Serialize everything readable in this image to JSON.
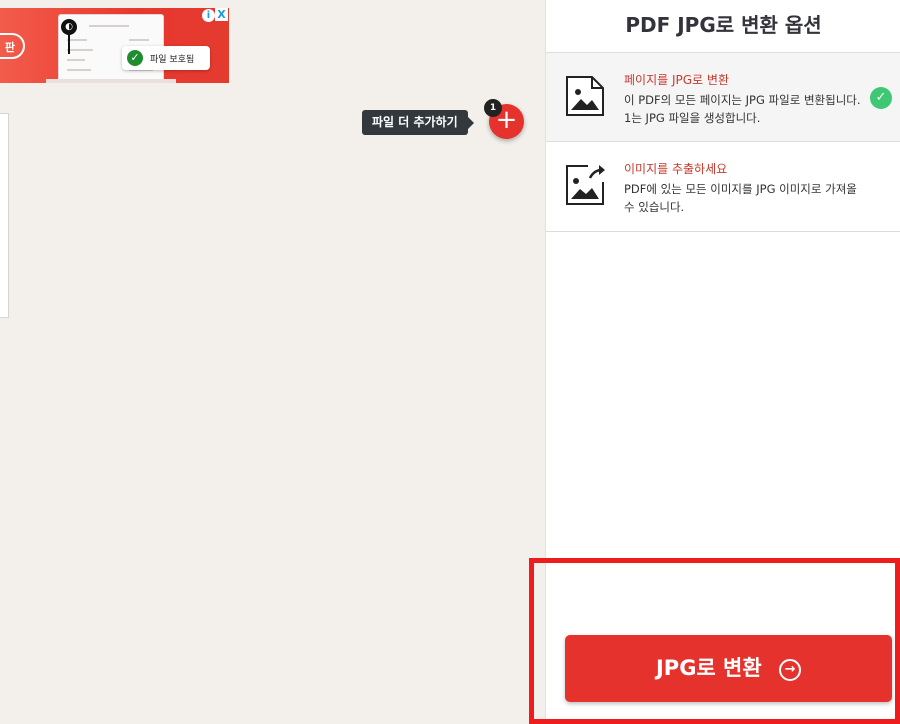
{
  "ad": {
    "pill_text": "판",
    "badge_text": "파일 보호됨",
    "check_icon": "check-circle-icon",
    "info_label": "i",
    "close_label": "X",
    "dark_icon_label": "◐",
    "color": "#e8372f"
  },
  "add_files": {
    "tooltip": "파일 더 추가하기",
    "count": "1",
    "icon": "plus-icon",
    "plus_label": "+"
  },
  "panel": {
    "title": "PDF JPG로 변환 옵션",
    "options": [
      {
        "title": "페이지를 JPG로 변환",
        "description": "이 PDF의 모든 페이지는 JPG 파일로 변환됩니다. 1는 JPG 파일을 생성합니다.",
        "icon": "image-page-icon",
        "selected": true,
        "check_label": "✓"
      },
      {
        "title": "이미지를 추출하세요",
        "description": "PDF에 있는 모든 이미지를 JPG 이미지로 가져올 수 있습니다.",
        "icon": "image-extract-icon",
        "selected": false
      }
    ]
  },
  "convert": {
    "label": "JPG로 변환",
    "arrow": "→",
    "icon": "arrow-circle-right-icon",
    "color": "#e5322d"
  },
  "colors": {
    "accent": "#e5322d",
    "selected_check": "#3fc873",
    "highlight": "#ee1c1c"
  }
}
